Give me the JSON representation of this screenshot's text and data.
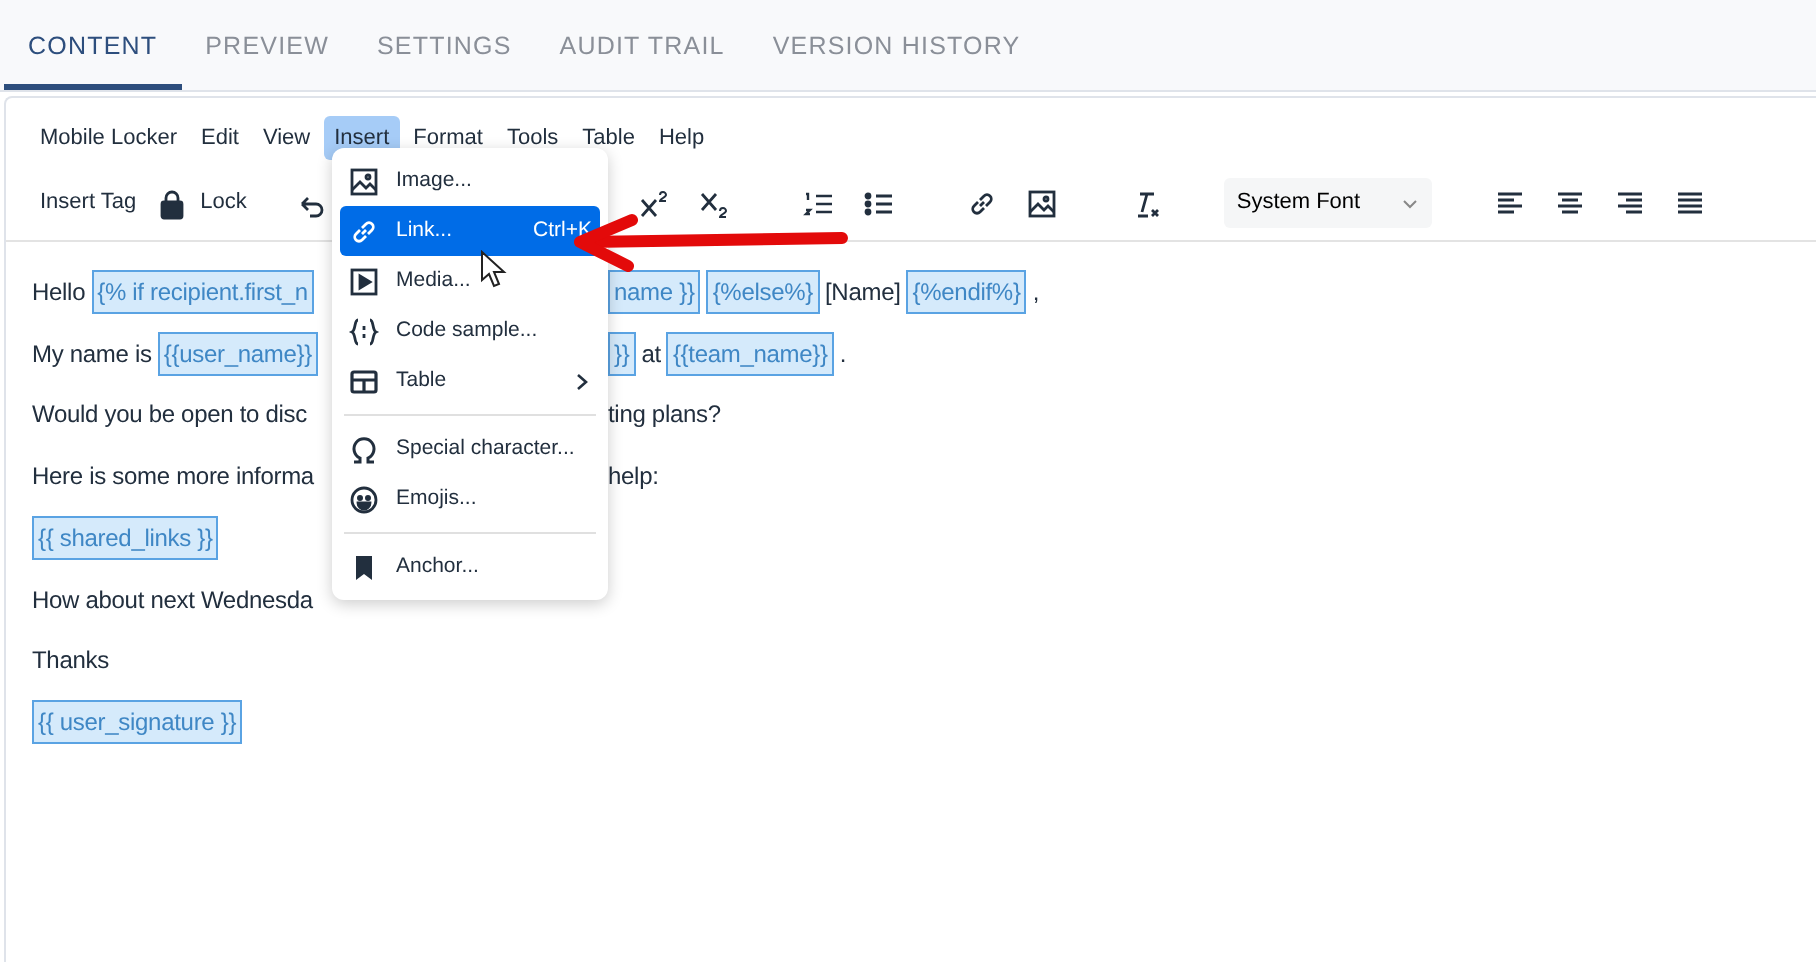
{
  "tabs": [
    {
      "label": "CONTENT",
      "selected": true
    },
    {
      "label": "PREVIEW",
      "selected": false
    },
    {
      "label": "SETTINGS",
      "selected": false
    },
    {
      "label": "AUDIT TRAIL",
      "selected": false
    },
    {
      "label": "VERSION HISTORY",
      "selected": false
    }
  ],
  "menubar": [
    {
      "label": "Mobile Locker",
      "selected": false
    },
    {
      "label": "Edit",
      "selected": false
    },
    {
      "label": "View",
      "selected": false
    },
    {
      "label": "Insert",
      "selected": true
    },
    {
      "label": "Format",
      "selected": false
    },
    {
      "label": "Tools",
      "selected": false
    },
    {
      "label": "Table",
      "selected": false
    },
    {
      "label": "Help",
      "selected": false
    }
  ],
  "toolbar": {
    "insert_tag": "Insert Tag",
    "lock": "Lock",
    "font": "System Font"
  },
  "lines": [
    {
      "left": [
        {
          "kind": "text",
          "text": "Hello"
        },
        {
          "kind": "tag",
          "text": "{% if recipient.first_n"
        }
      ],
      "right": [
        {
          "kind": "tag",
          "text": "name }}"
        },
        {
          "kind": "tag",
          "text": "{%else%}"
        },
        {
          "kind": "text",
          "text": "[Name]"
        },
        {
          "kind": "tag",
          "text": "{%endif%}"
        },
        {
          "kind": "text",
          "text": ","
        }
      ]
    },
    {
      "left": [
        {
          "kind": "text",
          "text": "My name is"
        },
        {
          "kind": "tag",
          "text": "{{user_name}}"
        }
      ],
      "right": [
        {
          "kind": "tag",
          "text": "}}"
        },
        {
          "kind": "text",
          "text": "at"
        },
        {
          "kind": "tag",
          "text": "{{team_name}}"
        },
        {
          "kind": "text",
          "text": "."
        }
      ]
    },
    {
      "left": [
        {
          "kind": "text",
          "text": "Would you be open to disc"
        }
      ],
      "right": [
        {
          "kind": "text",
          "text": "ting plans?"
        }
      ]
    },
    {
      "left": [
        {
          "kind": "text",
          "text": "Here is some more informa"
        }
      ],
      "right": [
        {
          "kind": "text",
          "text": "help:"
        }
      ]
    },
    {
      "left": [
        {
          "kind": "tag",
          "text": "{{ shared_links }}"
        }
      ]
    },
    {
      "left": [
        {
          "kind": "text",
          "text": "How about next Wednesda"
        }
      ]
    },
    {
      "left": [
        {
          "kind": "text",
          "text": "Thanks"
        }
      ]
    },
    {
      "left": [
        {
          "kind": "tag",
          "text": "{{ user_signature }}"
        }
      ]
    }
  ],
  "insert_menu": [
    {
      "kind": "item",
      "label": "Image...",
      "selected": false
    },
    {
      "kind": "item",
      "label": "Link...",
      "shortcut": "Ctrl+K",
      "selected": true
    },
    {
      "kind": "item",
      "label": "Media...",
      "selected": false
    },
    {
      "kind": "item",
      "label": "Code sample...",
      "selected": false
    },
    {
      "kind": "submenu",
      "label": "Table",
      "selected": false
    },
    {
      "kind": "divider"
    },
    {
      "kind": "item",
      "label": "Special character...",
      "selected": false
    },
    {
      "kind": "item",
      "label": "Emojis...",
      "selected": false
    },
    {
      "kind": "divider"
    },
    {
      "kind": "item",
      "label": "Anchor...",
      "selected": false
    }
  ]
}
